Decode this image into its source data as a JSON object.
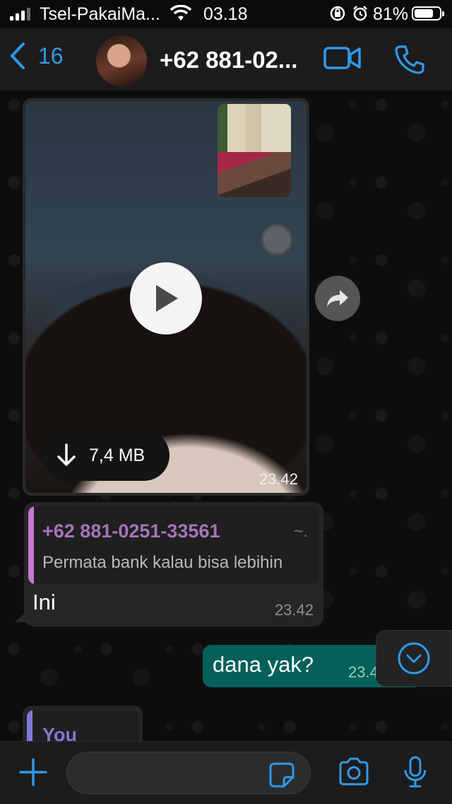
{
  "status_bar": {
    "carrier": "Tsel-PakaiMa...",
    "time": "03.18",
    "battery": "81%"
  },
  "header": {
    "back_count": "16",
    "contact": "+62 881-02...",
    "accent_color": "#2f9ae8"
  },
  "messages": {
    "video": {
      "download_size": "7,4 MB",
      "time": "23.42"
    },
    "reply": {
      "quote_sender": "+62 881-0251-33561",
      "quote_suffix": "~.",
      "quote_text": "Permata bank kalau bisa lebihin",
      "text": "Ini",
      "time": "23.42"
    },
    "outgoing": {
      "text": "dana yak?",
      "time": "23.4"
    },
    "partial": {
      "quote_label": "You"
    }
  },
  "input": {
    "placeholder": ""
  }
}
